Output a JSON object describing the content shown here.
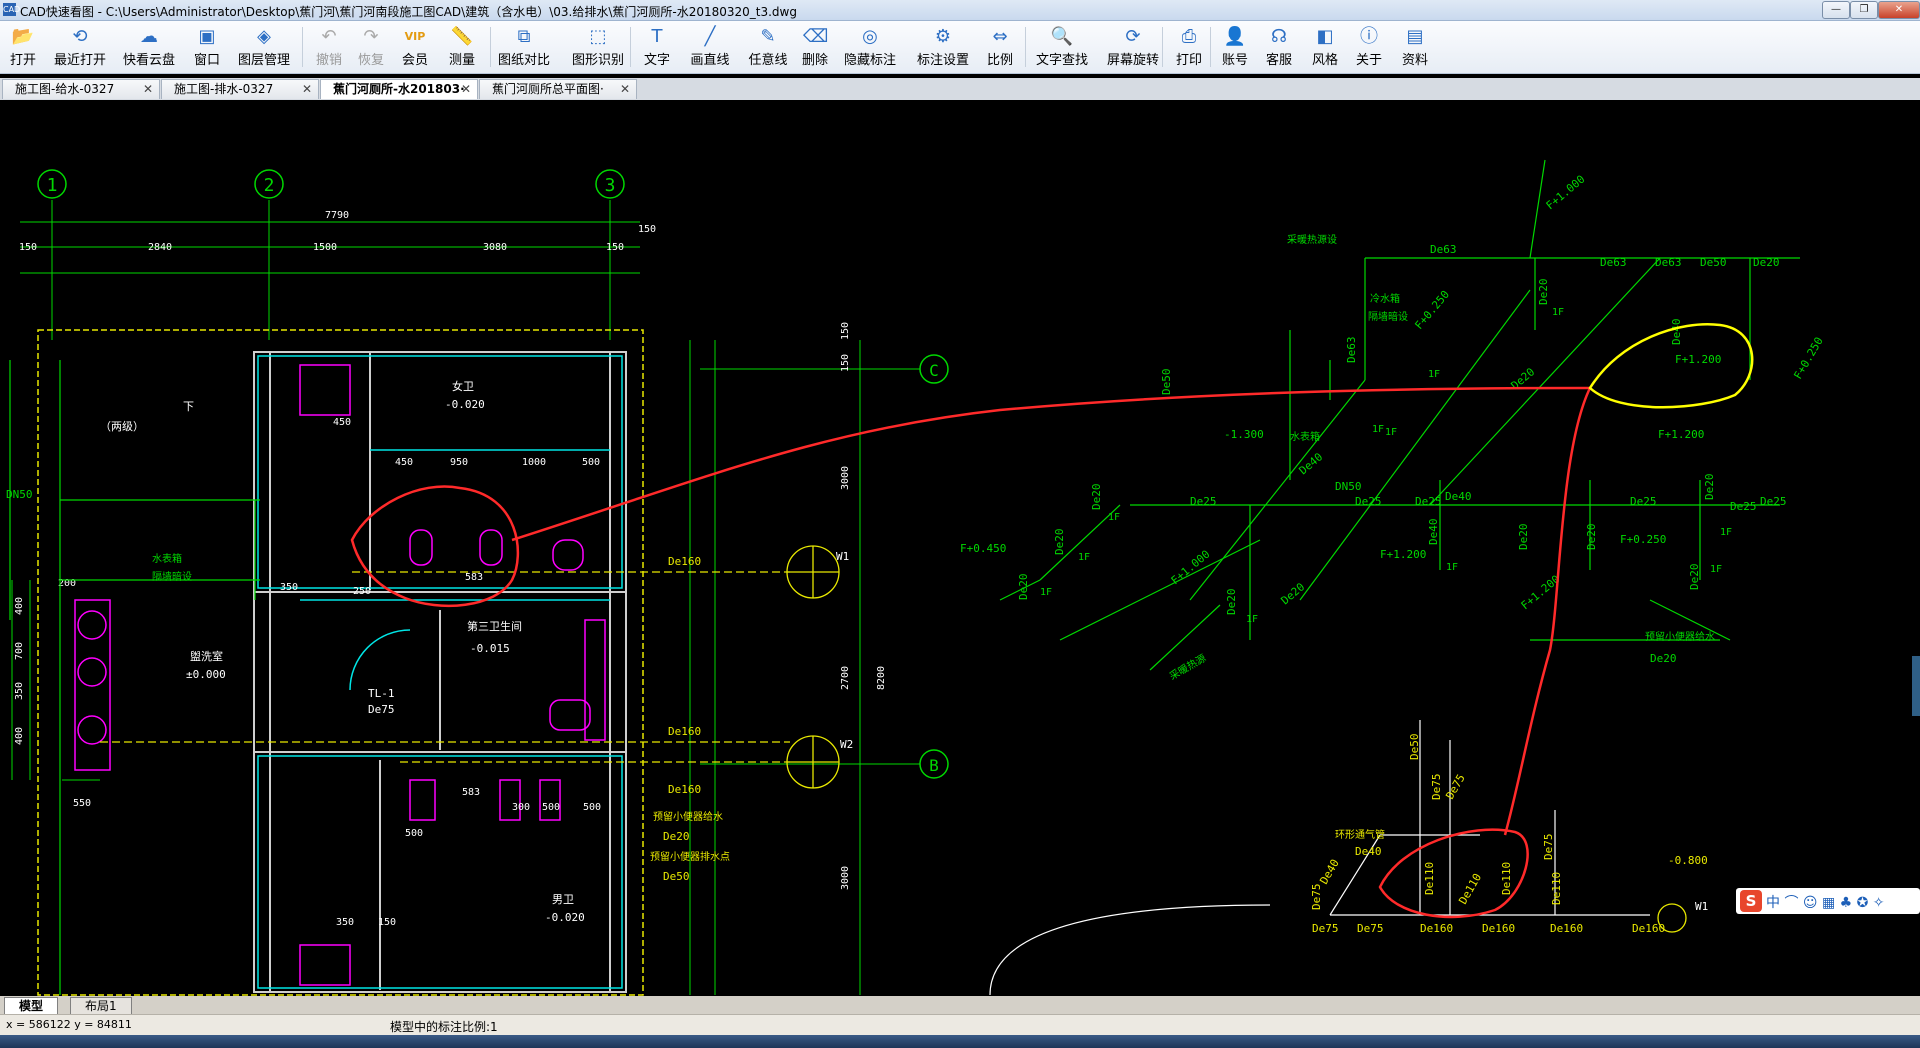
{
  "window": {
    "title": "CAD快速看图 - C:\\Users\\Administrator\\Desktop\\蕉门河\\蕉门河南段施工图CAD\\建筑（含水电）\\03.给排水\\蕉门河厕所-水20180320_t3.dwg",
    "app_icon": "CAD"
  },
  "toolbar": {
    "items": [
      {
        "label": "打开",
        "icon": "folder-open-icon"
      },
      {
        "label": "最近打开",
        "icon": "history-icon"
      },
      {
        "label": "快看云盘",
        "icon": "cloud-icon"
      },
      {
        "label": "窗口",
        "icon": "window-icon"
      },
      {
        "label": "图层管理",
        "icon": "layers-icon"
      },
      {
        "label": "撤销",
        "icon": "undo-icon"
      },
      {
        "label": "恢复",
        "icon": "redo-icon"
      },
      {
        "label": "会员",
        "icon": "vip-icon"
      },
      {
        "label": "测量",
        "icon": "ruler-icon"
      },
      {
        "label": "图纸对比",
        "icon": "compare-icon"
      },
      {
        "label": "图形识别",
        "icon": "shape-recognize-icon"
      },
      {
        "label": "文字",
        "icon": "text-icon"
      },
      {
        "label": "画直线",
        "icon": "line-icon"
      },
      {
        "label": "任意线",
        "icon": "freehand-icon"
      },
      {
        "label": "删除",
        "icon": "eraser-icon"
      },
      {
        "label": "隐藏标注",
        "icon": "hide-annotation-icon"
      },
      {
        "label": "标注设置",
        "icon": "annotation-settings-icon"
      },
      {
        "label": "比例",
        "icon": "scale-icon"
      },
      {
        "label": "文字查找",
        "icon": "text-search-icon"
      },
      {
        "label": "屏幕旋转",
        "icon": "rotate-screen-icon"
      },
      {
        "label": "打印",
        "icon": "printer-icon"
      },
      {
        "label": "账号",
        "icon": "account-icon"
      },
      {
        "label": "客服",
        "icon": "headset-icon"
      },
      {
        "label": "风格",
        "icon": "style-icon"
      },
      {
        "label": "关于",
        "icon": "info-icon"
      },
      {
        "label": "资料",
        "icon": "documents-icon"
      }
    ]
  },
  "tabs": [
    {
      "label": "施工图-给水-0327"
    },
    {
      "label": "施工图-排水-0327"
    },
    {
      "label": "蕉门河厕所-水201803·"
    },
    {
      "label": "蕉门河厕所总平面图·"
    }
  ],
  "layout_tabs": [
    "模型",
    "布局1"
  ],
  "status": {
    "coords": "x = 586122  y = 84811",
    "scale_text": "模型中的标注比例:1"
  },
  "ime": {
    "logo": "S",
    "text": "中 ⌒ ☺ ▦ ♣ ✪ ✧"
  },
  "drawing": {
    "axis_numbers": [
      "1",
      "2",
      "3"
    ],
    "axis_letters": [
      "C",
      "B"
    ],
    "dims_top": [
      "7790",
      "150",
      "2840",
      "1500",
      "3080",
      "150",
      "150"
    ],
    "dims_right": [
      "150",
      "150",
      "3000",
      "2700",
      "8200",
      "3000"
    ],
    "dims_left": [
      "400",
      "700",
      "350",
      "400",
      "200",
      "550"
    ],
    "rooms": [
      "女卫",
      "-0.020",
      "第三卫生间",
      "-0.015",
      "盥洗室",
      "±0.000",
      "男卫",
      "-0.020",
      "（两级）",
      "下"
    ],
    "room_dims": [
      "450",
      "950",
      "1000",
      "500",
      "450",
      "583",
      "350",
      "250",
      "300",
      "500",
      "500",
      "583",
      "500",
      "350",
      "150"
    ],
    "pipe_labels_plan": [
      "De160",
      "De160",
      "De160",
      "DN50",
      "TL-1",
      "De75",
      "W1",
      "W2",
      "De20",
      "De50"
    ],
    "notes_plan": [
      "水表箱",
      "隔墙暗设",
      "预留小便器给水",
      "预留小便器排水点"
    ],
    "iso_labels": [
      "De63",
      "De63",
      "De63",
      "De50",
      "De20",
      "De20",
      "De40",
      "De20",
      "De25",
      "De25",
      "De25",
      "De25",
      "De40",
      "De40",
      "De20",
      "De25",
      "De20",
      "De20",
      "De20",
      "De20",
      "De25",
      "De20",
      "De20",
      "De20",
      "De20",
      "De20",
      "DN50",
      "De40",
      "De50",
      "De63"
    ],
    "iso_levels": [
      "F+1.000",
      "F+0.250",
      "F+1.200",
      "F+1.200",
      "F+0.450",
      "F+1.000",
      "F+1.200",
      "F+0.250",
      "F+1.200",
      "F+0.250",
      "-1.300",
      "-0.800"
    ],
    "iso_small": [
      "1F",
      "1F",
      "1F",
      "1F",
      "1F",
      "1F",
      "1F",
      "1F",
      "1F",
      "1F",
      "1F"
    ],
    "iso_notes": [
      "采暖热源设",
      "冷水箱",
      "隔墙暗设",
      "水表箱",
      "预留小便器给水",
      "采暖热源"
    ],
    "drain_labels": [
      "De75",
      "De75",
      "De160",
      "De160",
      "De160",
      "De160",
      "De110",
      "De110",
      "De110",
      "De75",
      "De75",
      "De50",
      "De75",
      "De40",
      "De40",
      "De110",
      "De75",
      "W1"
    ],
    "drain_notes": [
      "环形通气管"
    ]
  }
}
